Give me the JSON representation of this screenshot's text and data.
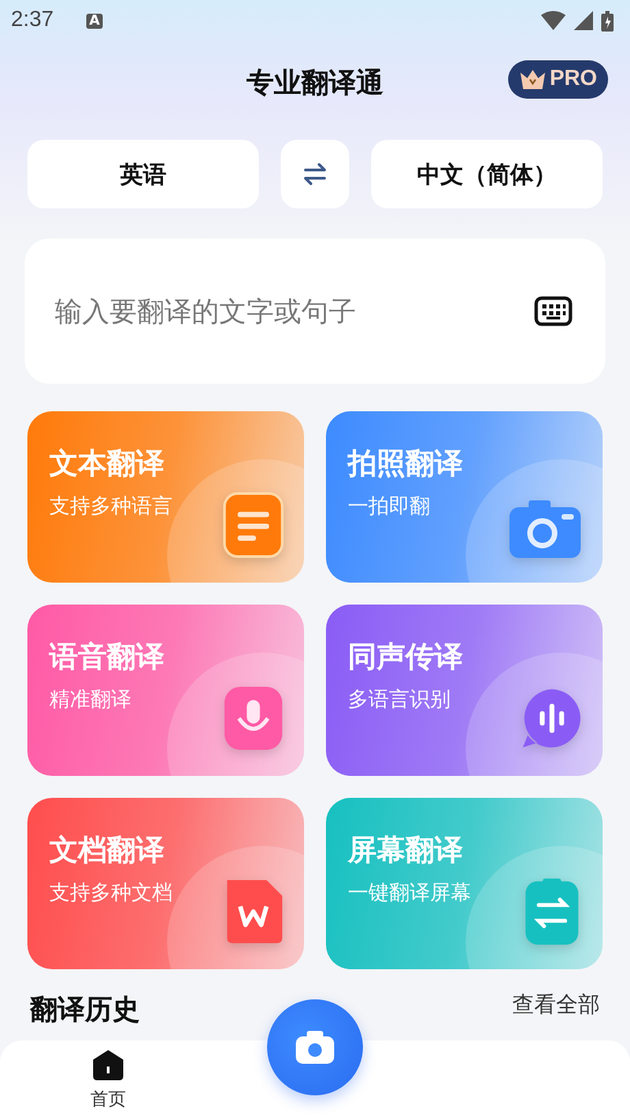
{
  "status_bar": {
    "time": "2:37",
    "notification_glyph": "A"
  },
  "header": {
    "title": "专业翻译通",
    "badge": "PRO"
  },
  "languages": {
    "source": "英语",
    "target": "中文（简体）"
  },
  "input": {
    "placeholder": "输入要翻译的文字或句子"
  },
  "features": [
    {
      "title": "文本翻译",
      "subtitle": "支持多种语言",
      "kind": "text",
      "color": "#ff7a0a"
    },
    {
      "title": "拍照翻译",
      "subtitle": "一拍即翻",
      "kind": "camera",
      "color": "#3d8bff"
    },
    {
      "title": "语音翻译",
      "subtitle": "精准翻译",
      "kind": "voice",
      "color": "#ff5aa5"
    },
    {
      "title": "同声传译",
      "subtitle": "多语言识别",
      "kind": "interpret",
      "color": "#8a5cf5"
    },
    {
      "title": "文档翻译",
      "subtitle": "支持多种文档",
      "kind": "document",
      "color": "#ff4d4d"
    },
    {
      "title": "屏幕翻译",
      "subtitle": "一键翻译屏幕",
      "kind": "screen",
      "color": "#17c0c0"
    }
  ],
  "history": {
    "title": "翻译历史",
    "more": "查看全部"
  },
  "bottom_nav": [
    {
      "label": "首页",
      "selected": true
    }
  ]
}
